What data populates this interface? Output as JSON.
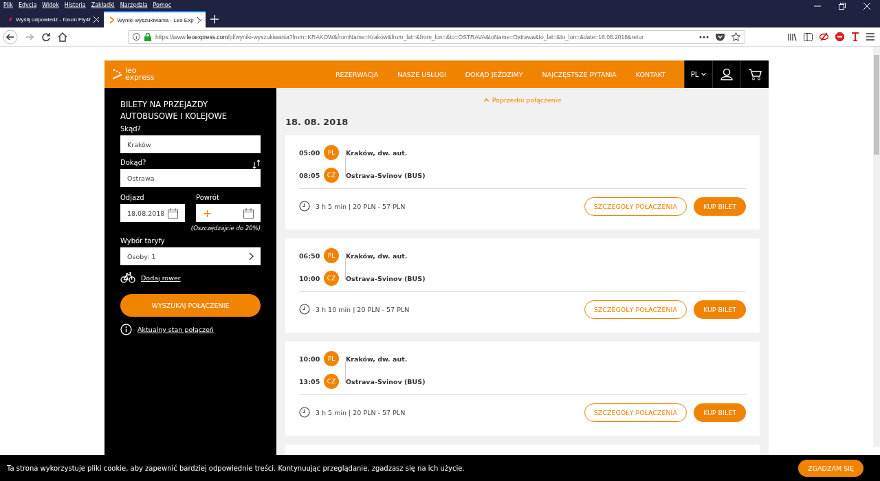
{
  "menu_bar": [
    "Plik",
    "Edycja",
    "Widok",
    "Historia",
    "Zakładki",
    "Narzędzia",
    "Pomoc"
  ],
  "tabs": [
    {
      "title": "Wyślij odpowiedź - forum Fly4f",
      "selected": false,
      "kind": "plane"
    },
    {
      "title": "Wyniki wyszukiwania - Leo Exp",
      "selected": true,
      "kind": "leo"
    }
  ],
  "address": {
    "prefix": "https://www.",
    "domain": "leoexpress.com",
    "rest": "/pl/wyniki-wyszukiwania?from=KRAKOW&fromName=Kraków&from_lat=&from_lon=&to=OSTRAVA&toName=Ostrawa&to_lat=&to_lon=&date=18.08.2018&retur"
  },
  "site": {
    "logo_top": "leo",
    "logo_bottom": "express",
    "nav": [
      "REZERWACJA",
      "NASZE USŁUGI",
      "DOKĄD JEŹDZIMY",
      "NAJCZĘSTSZE PYTANIA",
      "KONTAKT"
    ],
    "language": "PL"
  },
  "search_form": {
    "title": "BILETY NA PRZEJAZDY AUTOBUSOWE I KOLEJOWE",
    "from_label": "Skąd?",
    "from_value": "Kraków",
    "to_label": "Dokąd?",
    "to_value": "Ostrawa",
    "departure_label": "Odjazd",
    "departure_value": "18.08.2018",
    "return_label": "Powrót",
    "return_add": "+",
    "return_note": "(Oszczędzajcie do 20%)",
    "fare_label": "Wybór taryfy",
    "fare_value": "Osoby: 1",
    "bike_link": "Dodaj rower",
    "search_button": "WYSZUKAJ POŁĄCZENIE",
    "status_link": "Aktualny stan połączeń"
  },
  "results": {
    "previous_link": "Poprzedni połączenie",
    "date": "18. 08. 2018",
    "connections": [
      {
        "dep_time": "05:00",
        "dep_country": "PL",
        "dep_station": "Kraków, dw. aut.",
        "arr_time": "08:05",
        "arr_country": "CZ",
        "arr_station": "Ostrava-Svinov (BUS)",
        "summary": "3 h 5 min | 20 PLN - 57 PLN",
        "details_button": "SZCZEGÓŁY POŁĄCZENIA",
        "buy_button": "KUP BILET"
      },
      {
        "dep_time": "06:50",
        "dep_country": "PL",
        "dep_station": "Kraków, dw. aut.",
        "arr_time": "10:00",
        "arr_country": "CZ",
        "arr_station": "Ostrava-Svinov (BUS)",
        "summary": "3 h 10 min | 20 PLN - 57 PLN",
        "details_button": "SZCZEGÓŁY POŁĄCZENIA",
        "buy_button": "KUP BILET"
      },
      {
        "dep_time": "10:00",
        "dep_country": "PL",
        "dep_station": "Kraków, dw. aut.",
        "arr_time": "13:05",
        "arr_country": "CZ",
        "arr_station": "Ostrava-Svinov (BUS)",
        "summary": "3 h 5 min | 20 PLN - 57 PLN",
        "details_button": "SZCZEGÓŁY POŁĄCZENIA",
        "buy_button": "KUP BILET"
      }
    ]
  },
  "cookie_bar": {
    "text": "Ta strona wykorzystuje pliki cookie, aby zapewnić bardziej odpowiednie treści. Kontynuując przeglądanie, zgadzasz się na ich użycie.",
    "button": "ZGADZAM SIĘ"
  }
}
